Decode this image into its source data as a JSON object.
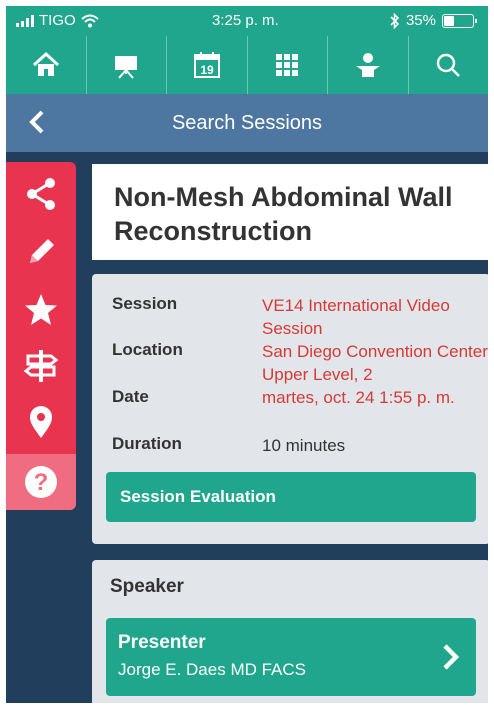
{
  "status_bar": {
    "carrier": "TIGO",
    "time": "3:25 p. m.",
    "battery_percent": "35%",
    "battery_level": 0.35
  },
  "nav": {
    "items": [
      {
        "icon": "home-icon"
      },
      {
        "icon": "presentation-easel-icon"
      },
      {
        "icon": "calendar-icon",
        "text": "19"
      },
      {
        "icon": "grid-icon"
      },
      {
        "icon": "person-icon"
      },
      {
        "icon": "search-icon"
      }
    ]
  },
  "titlebar": {
    "title": "Search Sessions",
    "back_icon": "chevron-left-icon"
  },
  "sidebar": {
    "icons": [
      "share-icon",
      "pencil-icon",
      "star-icon",
      "signpost-icon",
      "map-pin-icon",
      "help-icon"
    ]
  },
  "session": {
    "title": "Non-Mesh Abdominal Wall Reconstruction",
    "labels": {
      "session": "Session",
      "location": "Location",
      "date": "Date",
      "duration": "Duration"
    },
    "session_value": "VE14 International Video Session",
    "location_value": "San Diego Convention Center, Upper Level, 2",
    "date_value": "martes, oct. 24 1:55 p. m.",
    "duration_value": "10 minutes",
    "evaluation_button": "Session Evaluation"
  },
  "speaker": {
    "heading": "Speaker",
    "role": "Presenter",
    "name": "Jorge E. Daes MD FACS"
  },
  "colors": {
    "teal": "#1fa68c",
    "navy": "#213e5c",
    "title_blue": "#4d76a0",
    "sidebar_red": "#e8344f",
    "link_red": "#d63a36"
  }
}
